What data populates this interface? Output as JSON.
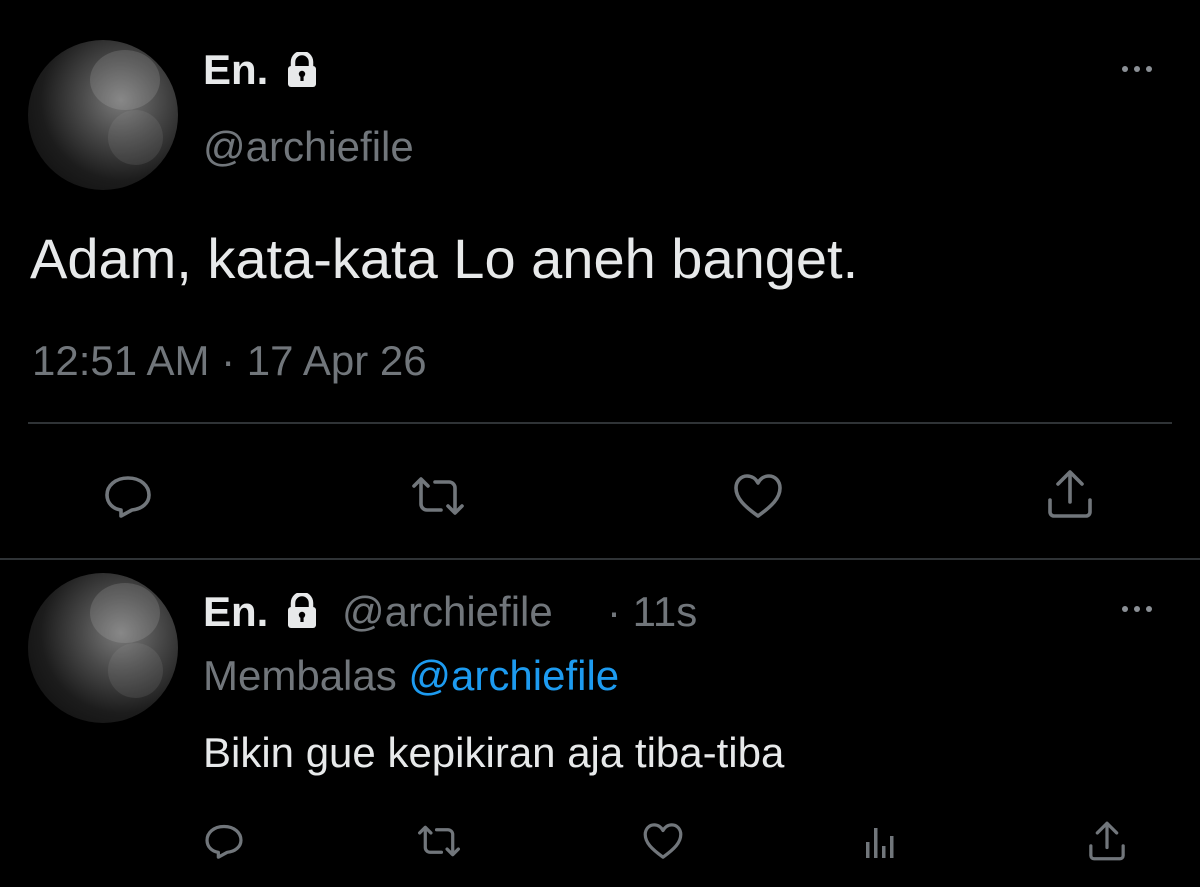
{
  "main_tweet": {
    "display_name": "En.",
    "handle": "@archiefile",
    "text": "Adam, kata-kata Lo aneh banget.",
    "timestamp": "12:51 AM · 17 Apr 26"
  },
  "reply_tweet": {
    "display_name": "En.",
    "handle": "@archiefile",
    "time_ago": "· 11s",
    "replying_prefix": "Membalas",
    "replying_to": "@archiefile",
    "text": "Bikin gue kepikiran aja tiba-tiba"
  },
  "icons": {
    "lock": "lock-icon",
    "more": "more-horizontal-icon",
    "reply": "reply-icon",
    "retweet": "retweet-icon",
    "like": "heart-icon",
    "analytics": "analytics-icon",
    "share": "share-icon"
  },
  "colors": {
    "background": "#000000",
    "text": "#e7e9ea",
    "muted": "#71767b",
    "link": "#1d9bf0",
    "divider": "#2f3336"
  }
}
